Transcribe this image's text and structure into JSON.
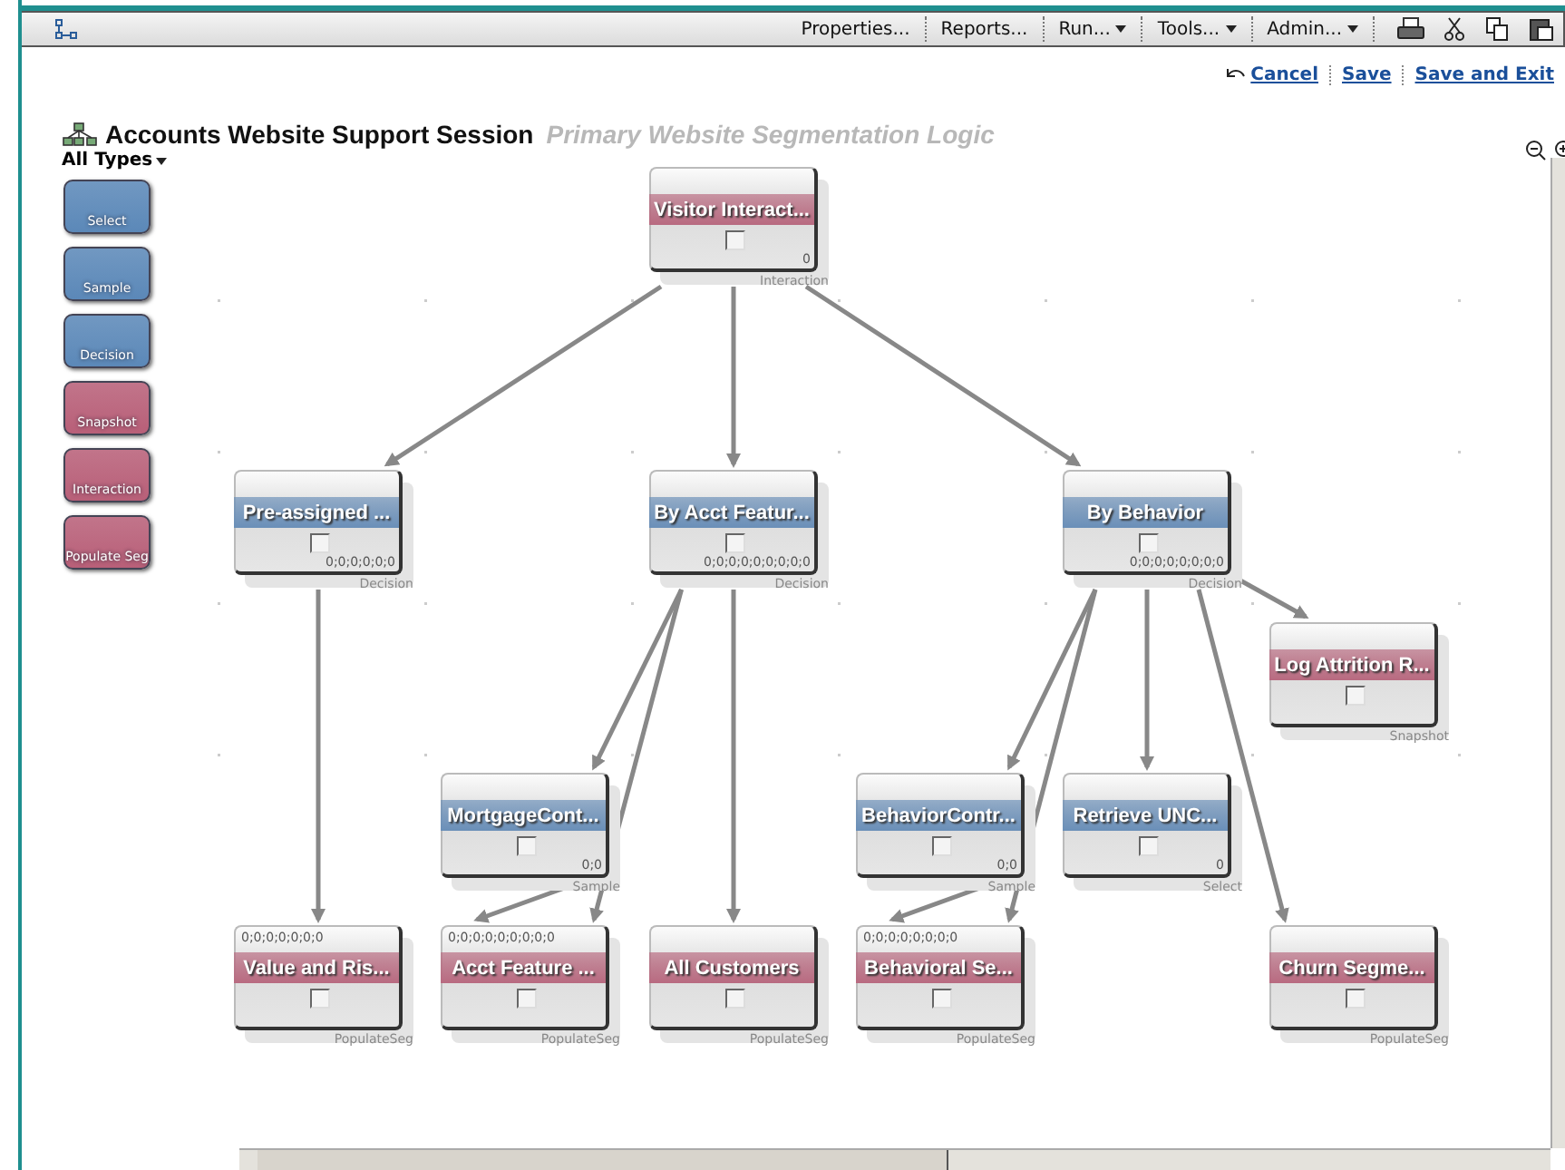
{
  "toolbar": {
    "menus": [
      {
        "label": "Properties...",
        "dropdown": false
      },
      {
        "label": "Reports...",
        "dropdown": false
      },
      {
        "label": "Run...",
        "dropdown": true
      },
      {
        "label": "Tools...",
        "dropdown": true
      },
      {
        "label": "Admin...",
        "dropdown": true
      }
    ]
  },
  "actions": [
    {
      "label": "Cancel",
      "kind": "undo"
    },
    {
      "label": "Save",
      "kind": "plain"
    },
    {
      "label": "Save and Exit",
      "kind": "plain"
    }
  ],
  "title": {
    "name": "Accounts Website Support Session",
    "subtitle": "Primary Website Segmentation Logic"
  },
  "palette": {
    "filter": "All Types",
    "items": [
      {
        "label": "Select",
        "color": "#5b88b8"
      },
      {
        "label": "Sample",
        "color": "#5b88b8"
      },
      {
        "label": "Decision",
        "color": "#5b88b8"
      },
      {
        "label": "Snapshot",
        "color": "#b85f78"
      },
      {
        "label": "Interaction",
        "color": "#b85f78"
      },
      {
        "label": "Populate Seg",
        "color": "#b85f78"
      }
    ]
  },
  "nodes": [
    {
      "label": "Visitor Interact...",
      "color": "#b86a80",
      "count": "0",
      "type": "Interaction",
      "checked": false
    },
    {
      "label": "Pre-assigned ...",
      "color": "#6a8fb8",
      "count": "0;0;0;0;0;0",
      "type": "Decision",
      "checked": false
    },
    {
      "label": "By Acct Featur...",
      "color": "#6a8fb8",
      "count": "0;0;0;0;0;0;0;0;0",
      "type": "Decision",
      "checked": false
    },
    {
      "label": "By Behavior",
      "color": "#6a8fb8",
      "count": "0;0;0;0;0;0;0;0",
      "type": "Decision",
      "checked": false
    },
    {
      "label": "Log Attrition R...",
      "color": "#b86a80",
      "type": "Snapshot",
      "checked": false
    },
    {
      "label": "MortgageCont...",
      "color": "#6a8fb8",
      "count": "0;0",
      "type": "Sample",
      "checked": false
    },
    {
      "label": "BehaviorContr...",
      "color": "#6a8fb8",
      "count": "0;0",
      "type": "Sample",
      "checked": false
    },
    {
      "label": "Retrieve UNC...",
      "color": "#6a8fb8",
      "count": "0",
      "type": "Select",
      "checked": false
    },
    {
      "label": "Value and Ris...",
      "color": "#b86a80",
      "top_count": "0;0;0;0;0;0;0",
      "type": "PopulateSeg",
      "checked": false
    },
    {
      "label": "Acct Feature ...",
      "color": "#b86a80",
      "top_count": "0;0;0;0;0;0;0;0;0",
      "type": "PopulateSeg",
      "checked": false
    },
    {
      "label": "All Customers",
      "color": "#b86a80",
      "type": "PopulateSeg",
      "checked": false
    },
    {
      "label": "Behavioral Se...",
      "color": "#b86a80",
      "top_count": "0;0;0;0;0;0;0;0",
      "type": "PopulateSeg",
      "checked": false
    },
    {
      "label": "Churn Segme...",
      "color": "#b86a80",
      "type": "PopulateSeg",
      "checked": false
    }
  ]
}
